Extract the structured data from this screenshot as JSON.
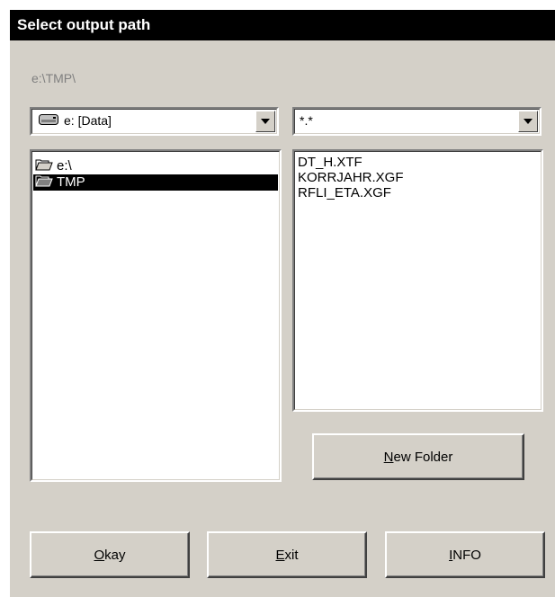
{
  "dialog": {
    "title": "Select output path",
    "current_path": "e:\\TMP\\"
  },
  "drive_select": {
    "value": "e: [Data]",
    "icon": "drive-icon"
  },
  "filter_select": {
    "value": "*.*"
  },
  "directory_list": {
    "items": [
      {
        "label": "e:\\",
        "icon": "open-folder-icon",
        "selected": false
      },
      {
        "label": "TMP",
        "icon": "open-folder-icon",
        "selected": true
      }
    ]
  },
  "file_list": {
    "items": [
      "DT_H.XTF",
      "KORRJAHR.XGF",
      "RFLI_ETA.XGF"
    ]
  },
  "buttons": {
    "new_folder": {
      "mnemonic": "N",
      "rest": "ew Folder"
    },
    "okay": {
      "mnemonic": "O",
      "rest": "kay"
    },
    "exit": {
      "mnemonic": "E",
      "rest": "xit"
    },
    "info": {
      "mnemonic": "I",
      "rest": "NFO"
    }
  },
  "colors": {
    "face": "#d4d0c8",
    "titlebar": "#000000",
    "selection": "#000000"
  }
}
